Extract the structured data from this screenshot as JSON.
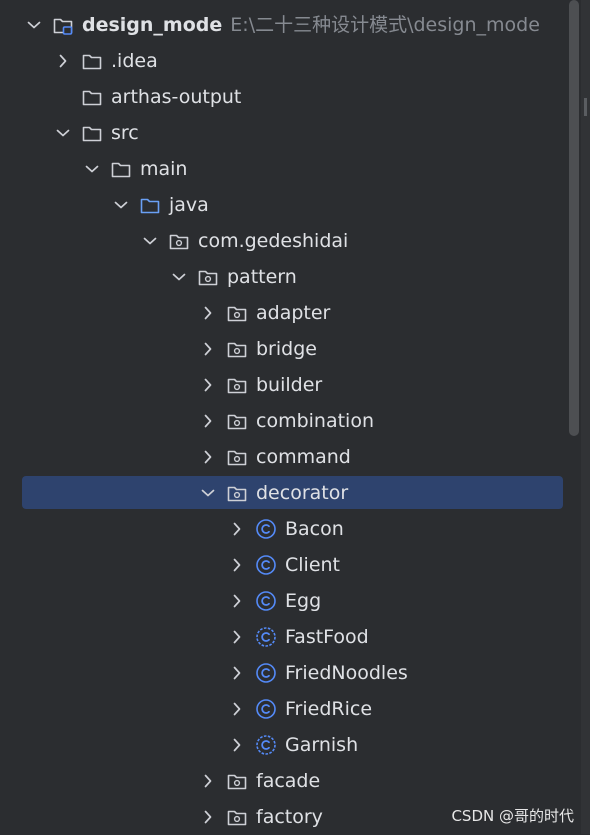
{
  "project": {
    "name": "design_mode",
    "path": "E:\\二十三种设计模式\\design_mode"
  },
  "rows": [
    {
      "label": "design_mode",
      "depth": 0,
      "chevron": "down",
      "icon": "module-folder-icon"
    },
    {
      "label": ".idea",
      "depth": 1,
      "chevron": "right",
      "icon": "folder-icon"
    },
    {
      "label": "arthas-output",
      "depth": 1,
      "chevron": "none",
      "icon": "folder-icon"
    },
    {
      "label": "src",
      "depth": 1,
      "chevron": "down",
      "icon": "folder-icon"
    },
    {
      "label": "main",
      "depth": 2,
      "chevron": "down",
      "icon": "folder-icon"
    },
    {
      "label": "java",
      "depth": 3,
      "chevron": "down",
      "icon": "source-folder-icon"
    },
    {
      "label": "com.gedeshidai",
      "depth": 4,
      "chevron": "down",
      "icon": "package-icon"
    },
    {
      "label": "pattern",
      "depth": 5,
      "chevron": "down",
      "icon": "package-icon"
    },
    {
      "label": "adapter",
      "depth": 6,
      "chevron": "right",
      "icon": "package-icon"
    },
    {
      "label": "bridge",
      "depth": 6,
      "chevron": "right",
      "icon": "package-icon"
    },
    {
      "label": "builder",
      "depth": 6,
      "chevron": "right",
      "icon": "package-icon"
    },
    {
      "label": "combination",
      "depth": 6,
      "chevron": "right",
      "icon": "package-icon"
    },
    {
      "label": "command",
      "depth": 6,
      "chevron": "right",
      "icon": "package-icon"
    },
    {
      "label": "decorator",
      "depth": 6,
      "chevron": "down",
      "icon": "package-icon",
      "selected": true
    },
    {
      "label": "Bacon",
      "depth": 7,
      "chevron": "right",
      "icon": "class-icon"
    },
    {
      "label": "Client",
      "depth": 7,
      "chevron": "right",
      "icon": "class-icon"
    },
    {
      "label": "Egg",
      "depth": 7,
      "chevron": "right",
      "icon": "class-icon"
    },
    {
      "label": "FastFood",
      "depth": 7,
      "chevron": "right",
      "icon": "abstract-class-icon"
    },
    {
      "label": "FriedNoodles",
      "depth": 7,
      "chevron": "right",
      "icon": "class-icon"
    },
    {
      "label": "FriedRice",
      "depth": 7,
      "chevron": "right",
      "icon": "class-icon"
    },
    {
      "label": "Garnish",
      "depth": 7,
      "chevron": "right",
      "icon": "abstract-class-icon"
    },
    {
      "label": "facade",
      "depth": 6,
      "chevron": "right",
      "icon": "package-icon"
    },
    {
      "label": "factory",
      "depth": 6,
      "chevron": "right",
      "icon": "package-icon"
    }
  ],
  "watermark": "CSDN @哥的时代",
  "colors": {
    "background": "#2b2d30",
    "selection": "#2e436e",
    "text": "#dfe1e5",
    "path": "#868a91",
    "class_icon": "#548af7",
    "source_folder": "#6aa0f5"
  }
}
